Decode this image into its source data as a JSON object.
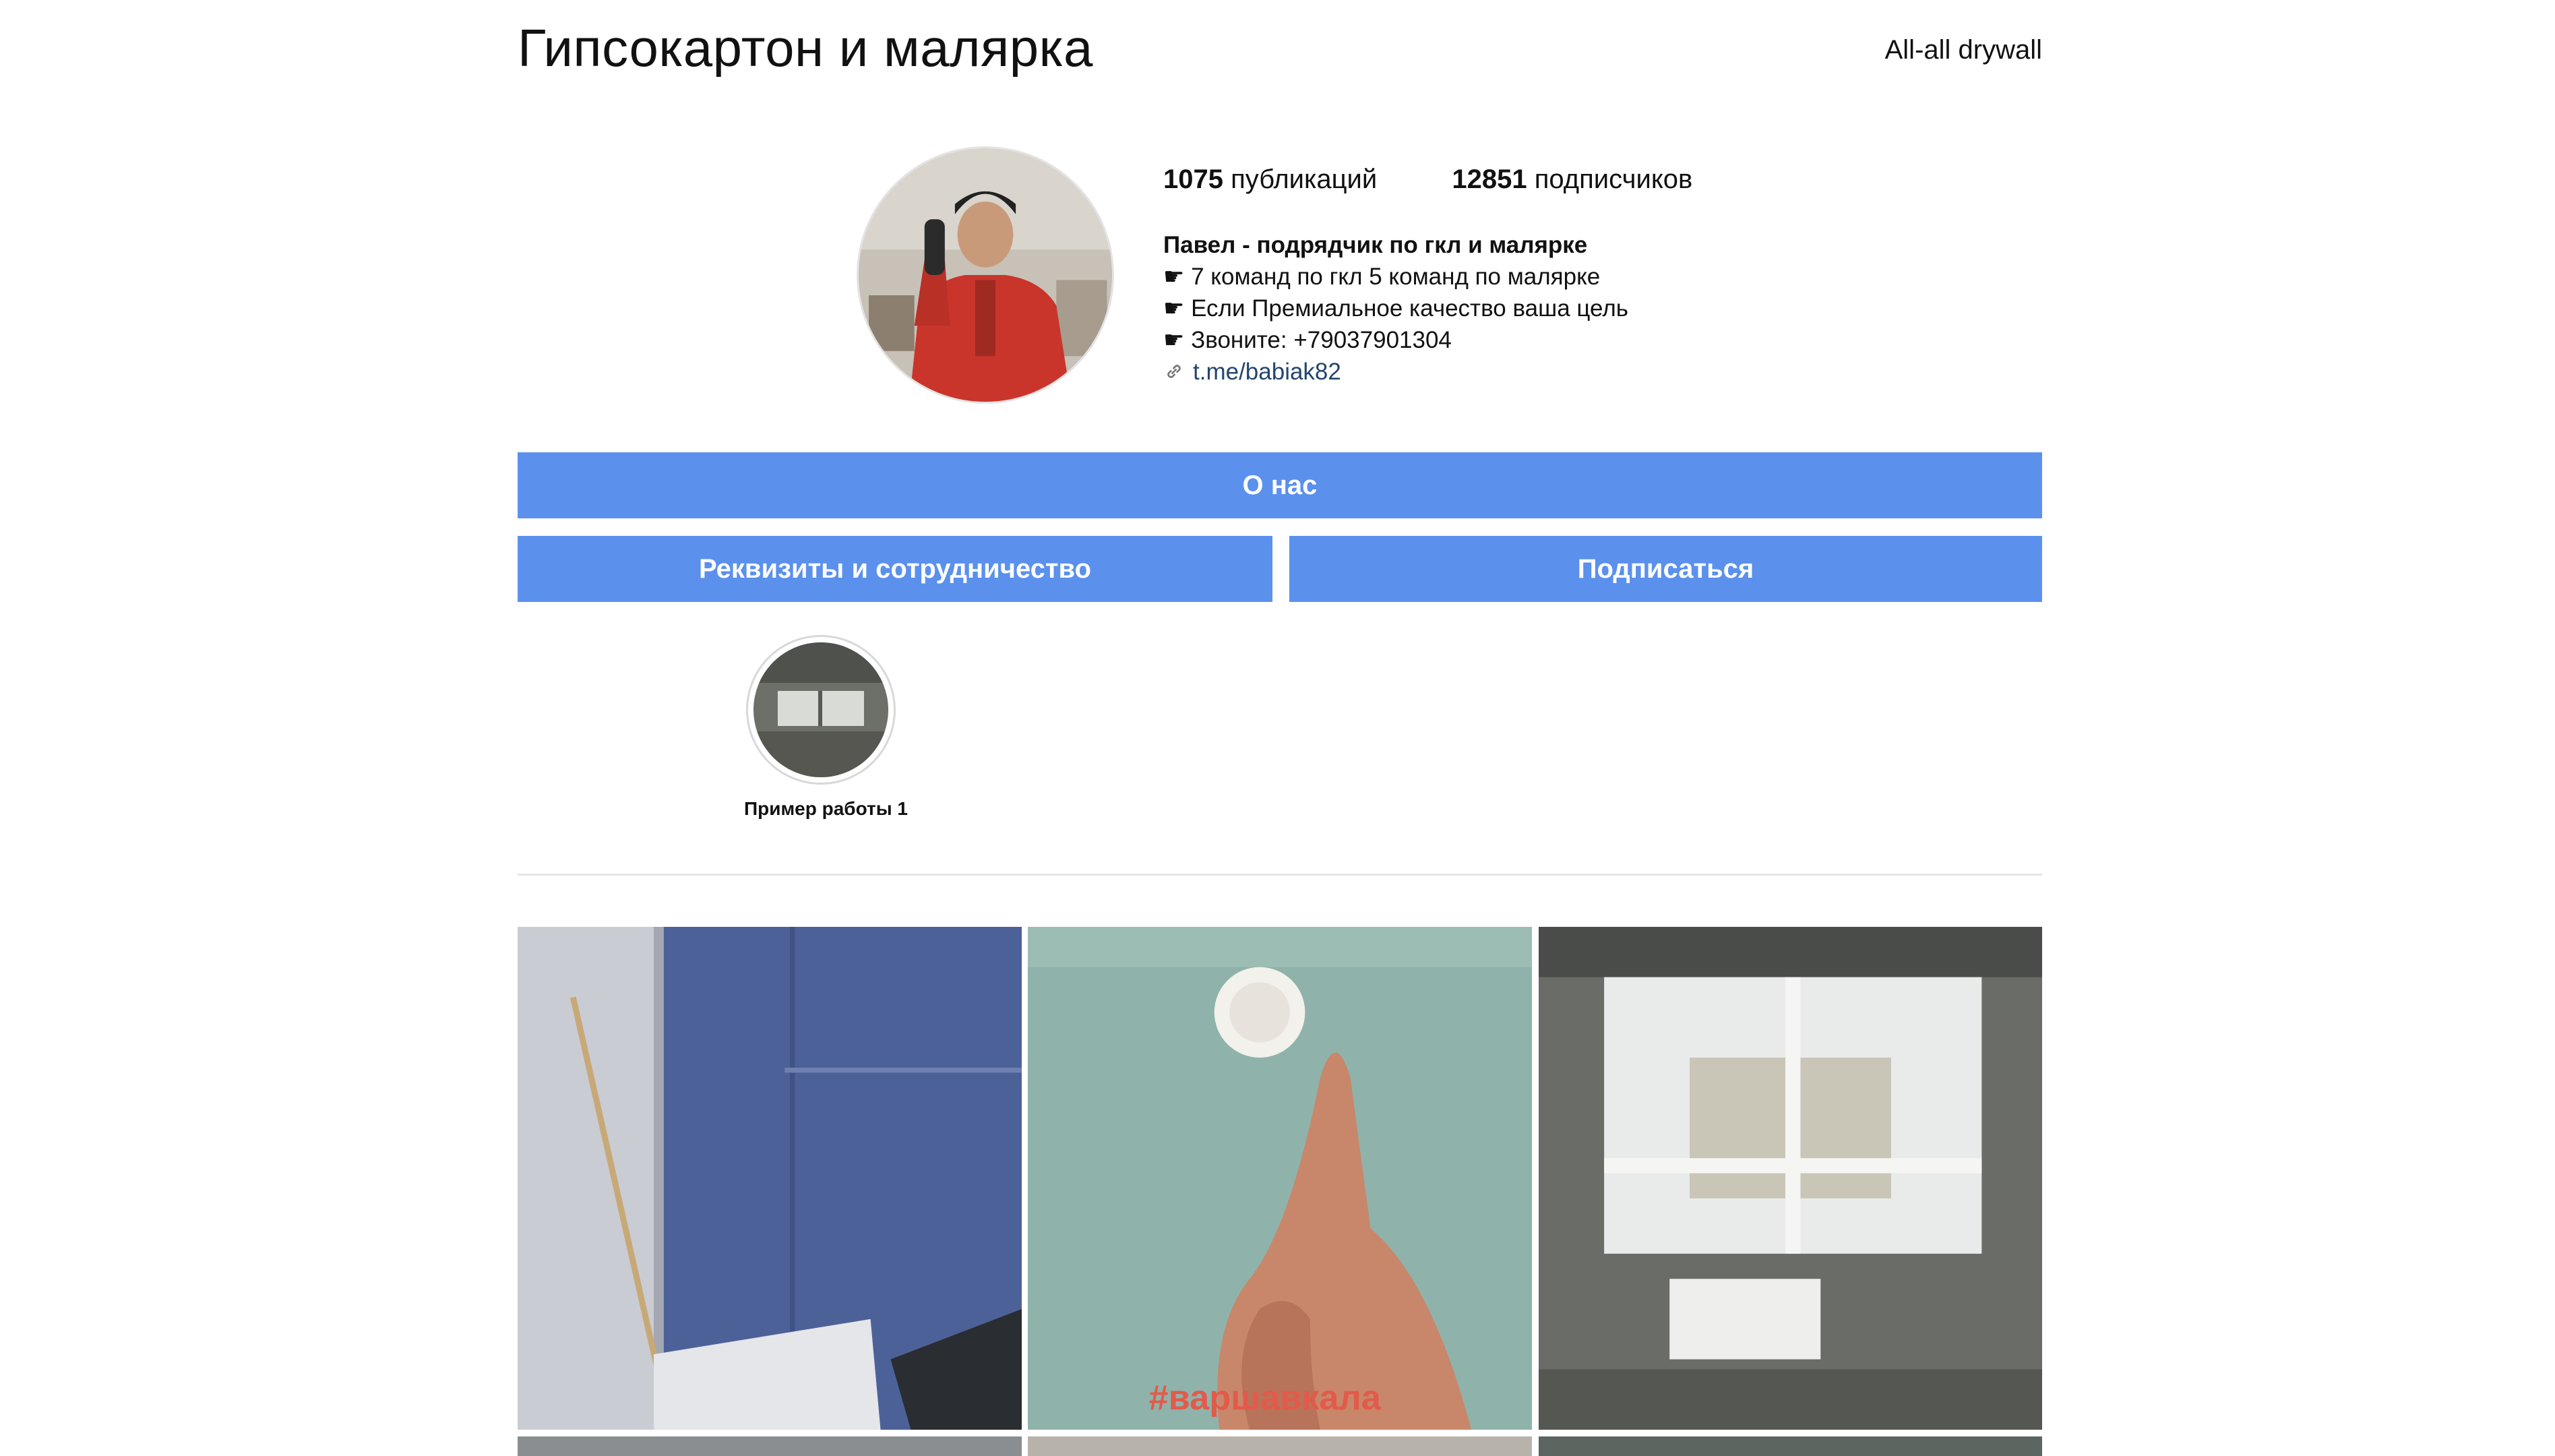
{
  "header": {
    "title": "Гипсокартон и малярка",
    "username": "All-all drywall"
  },
  "profile": {
    "posts_count": "1075",
    "posts_label": "публикаций",
    "followers_count": "12851",
    "followers_label": "подписчиков",
    "bio_name": "Павел - подрядчик по гкл и малярке",
    "bio_lines": [
      "☛ 7 команд по гкл 5 команд по малярке",
      "☛ Если Премиальное качество ваша цель",
      "☛ Звоните: +79037901304"
    ],
    "link_text": "t.me/babiak82"
  },
  "buttons": {
    "about": "О нас",
    "requisites": "Реквизиты и сотрудничество",
    "subscribe": "Подписаться"
  },
  "highlights": [
    {
      "label": "Пример работы 1"
    }
  ],
  "posts": [
    {
      "overlay_text": ""
    },
    {
      "overlay_text": "#варшавкала"
    },
    {
      "overlay_text": ""
    }
  ],
  "colors": {
    "button_bg": "#5b91ed",
    "link": "#23456d"
  },
  "icons": {
    "link": "link-icon"
  }
}
